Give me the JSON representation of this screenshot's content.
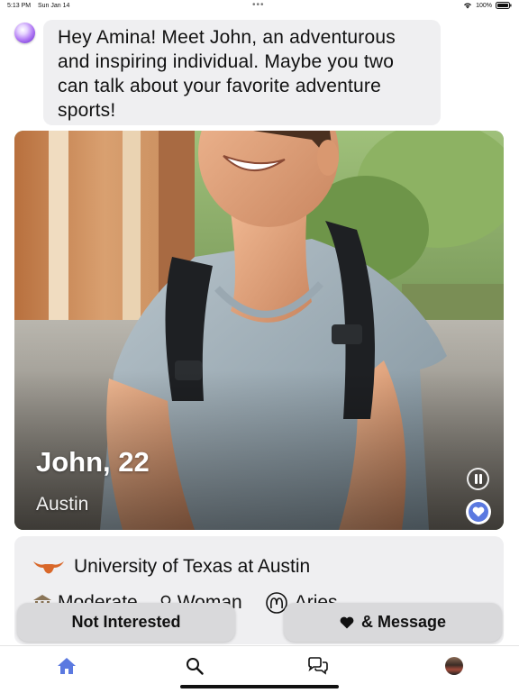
{
  "status_bar": {
    "time": "5:13 PM",
    "date": "Sun Jan 14",
    "dots": "•••",
    "battery": "100%"
  },
  "assistant": {
    "message": "Hey Amina! Meet John, an adventurous and inspiring individual. Maybe you two can talk about your favorite adventure sports!"
  },
  "profile": {
    "name_age": "John, 22",
    "city": "Austin"
  },
  "details": {
    "school": "University of Texas at Austin",
    "tags": [
      {
        "label": "Moderate",
        "icon": "politics-icon"
      },
      {
        "label": "Woman",
        "icon": "gender-icon"
      },
      {
        "label": "Aries",
        "icon": "zodiac-icon"
      }
    ]
  },
  "actions": {
    "not_interested": "Not Interested",
    "message": "& Message"
  },
  "tabs": [
    "home",
    "search",
    "chats",
    "profile"
  ],
  "colors": {
    "accent": "#5b79e0",
    "bubble_bg": "#efeff1",
    "button_bg": "#d9d9db",
    "longhorn": "#d9682a"
  }
}
